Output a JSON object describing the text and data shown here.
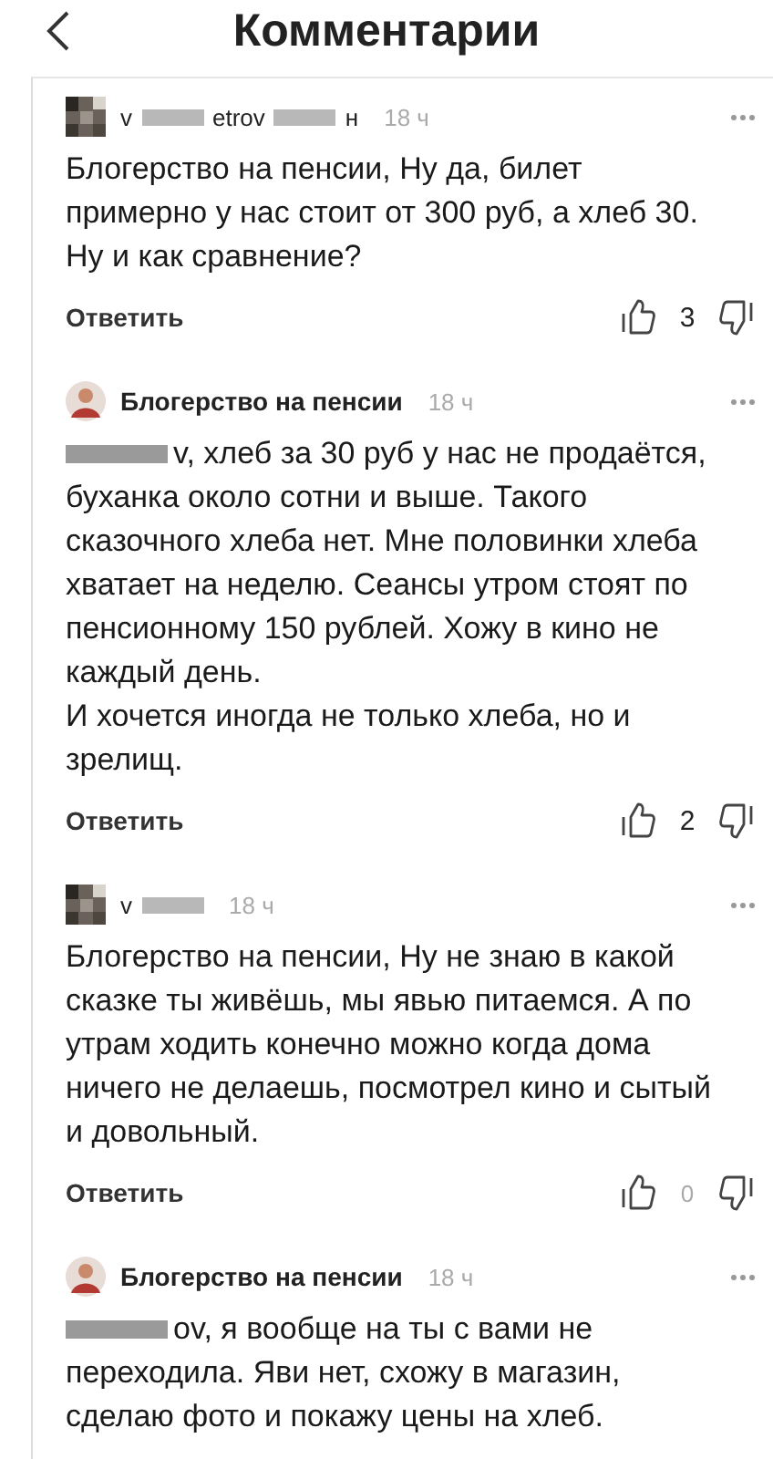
{
  "header": {
    "title": "Комментарии"
  },
  "comments": [
    {
      "avatar": {
        "kind": "pixelated"
      },
      "author": [
        {
          "kind": "text",
          "text": "v"
        },
        {
          "kind": "redacted"
        },
        {
          "kind": "text",
          "text": "etrov"
        },
        {
          "kind": "redacted"
        },
        {
          "kind": "text",
          "text": "н"
        }
      ],
      "author_bold": false,
      "time": "18 ч",
      "body": {
        "redacted_start": false,
        "text": "Блогерство на пенсии, Ну да, билет примерно у нас стоит от 300 руб, а хлеб 30. Ну и как сравнение?"
      },
      "reply": "Ответить",
      "likes": "3",
      "likes_zero": false
    },
    {
      "avatar": {
        "kind": "figure"
      },
      "author": [
        {
          "kind": "text",
          "text": "Блогерство на пенсии"
        }
      ],
      "author_bold": true,
      "time": "18 ч",
      "body": {
        "redacted_start": true,
        "text": "v, хлеб за 30 руб у нас не продаётся, буханка около сотни и выше. Такого сказочного хлеба нет. Мне половинки хлеба хватает на неделю. Сеансы утром стоят по пенсионному 150 рублей. Хожу в кино не каждый день.\nИ хочется иногда не только хлеба, но и зрелищ."
      },
      "reply": "Ответить",
      "likes": "2",
      "likes_zero": false
    },
    {
      "avatar": {
        "kind": "pixelated"
      },
      "author": [
        {
          "kind": "text",
          "text": "v"
        },
        {
          "kind": "redacted"
        }
      ],
      "author_bold": false,
      "time": "18 ч",
      "body": {
        "redacted_start": false,
        "text": "Блогерство на пенсии, Ну не знаю в какой сказке ты живёшь, мы явью питаемся. А по утрам ходить конечно можно когда дома ничего не делаешь, посмотрел кино и сытый и довольный."
      },
      "reply": "Ответить",
      "likes": "0",
      "likes_zero": true
    },
    {
      "avatar": {
        "kind": "figure"
      },
      "author": [
        {
          "kind": "text",
          "text": "Блогерство на пенсии"
        }
      ],
      "author_bold": true,
      "time": "18 ч",
      "body": {
        "redacted_start": true,
        "text": "ov, я вообще на ты с вами не переходила. Яви нет, схожу в магазин, сделаю фото и покажу цены на хлеб."
      }
    }
  ]
}
